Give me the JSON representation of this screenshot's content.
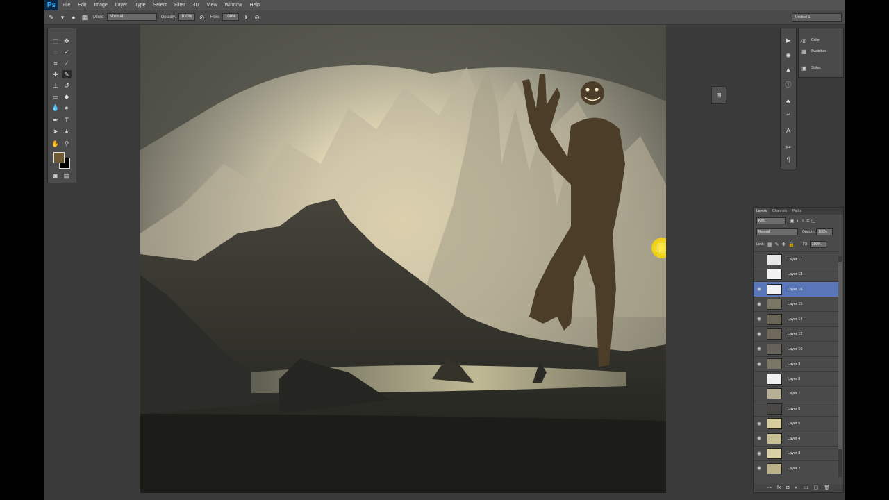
{
  "menubar": {
    "logo": "Ps",
    "items": [
      "File",
      "Edit",
      "Image",
      "Layer",
      "Type",
      "Select",
      "Filter",
      "3D",
      "View",
      "Window",
      "Help"
    ]
  },
  "options": {
    "mode_label": "Mode:",
    "mode_value": "Normal",
    "opacity_label": "Opacity:",
    "opacity_value": "100%",
    "flow_label": "Flow:",
    "flow_value": "100%",
    "workspace": "Untitled-1"
  },
  "colors": {
    "foreground": "#6e5a34",
    "background": "#000000",
    "accent_selection": "#5876b8"
  },
  "panels": {
    "mini": [
      "Color",
      "Swatches",
      "Styles"
    ],
    "strip_icons": [
      "play-icon",
      "brightness-icon",
      "levels-icon",
      "info-icon",
      "brush-presets-icon",
      "adjust-icon",
      "character-icon",
      "tools-icon",
      "paragraph-icon"
    ]
  },
  "layers": {
    "tabs": [
      "Layers",
      "Channels",
      "Paths"
    ],
    "kind": "Kind",
    "blend": "Normal",
    "opacity_label": "Opacity:",
    "opacity": "100%",
    "lock_label": "Lock:",
    "fill_label": "Fill:",
    "fill": "100%",
    "items": [
      {
        "name": "Layer 11",
        "visible": false,
        "thumb": "#e8e8e8"
      },
      {
        "name": "Layer 13",
        "visible": false,
        "thumb": "#f2f2f2"
      },
      {
        "name": "Layer 16",
        "visible": true,
        "selected": true,
        "thumb": "#f4f4f4"
      },
      {
        "name": "Layer 15",
        "visible": true,
        "thumb": "#7a7664"
      },
      {
        "name": "Layer 14",
        "visible": true,
        "thumb": "#6a6658"
      },
      {
        "name": "Layer 12",
        "visible": true,
        "thumb": "#706a5c"
      },
      {
        "name": "Layer 10",
        "visible": true,
        "thumb": "#66625a"
      },
      {
        "name": "Layer 9",
        "visible": true,
        "thumb": "#7a7666"
      },
      {
        "name": "Layer 8",
        "visible": false,
        "thumb": "#f0f0f0"
      },
      {
        "name": "Layer 7",
        "visible": false,
        "thumb": "#b8b094"
      },
      {
        "name": "Layer 6",
        "visible": false,
        "thumb": "#4a4844"
      },
      {
        "name": "Layer 5",
        "visible": true,
        "thumb": "#d6cc9e"
      },
      {
        "name": "Layer 4",
        "visible": true,
        "thumb": "#c8bf94"
      },
      {
        "name": "Layer 3",
        "visible": true,
        "thumb": "#d8d0a4"
      },
      {
        "name": "Layer 2",
        "visible": true,
        "thumb": "#bcb28a"
      }
    ]
  }
}
